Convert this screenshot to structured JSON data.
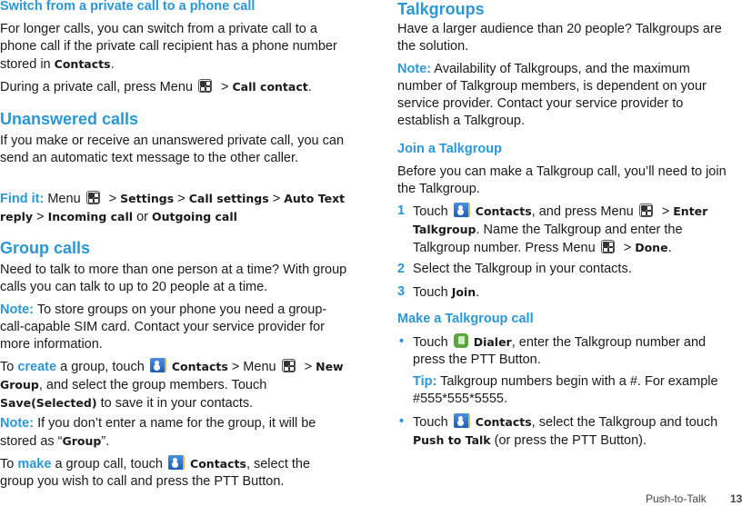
{
  "left": {
    "switch": {
      "heading": "Switch from a private call to a phone call",
      "p1_a": "For longer calls, you can switch from a private call to a phone call if the private call recipient has a phone number stored in ",
      "p1_b": "Contacts",
      "p1_c": ".",
      "p2_a": "During a private call, press Menu",
      "p2_b": " > ",
      "p2_c": "Call contact",
      "p2_d": "."
    },
    "unanswered": {
      "heading": "Unanswered calls",
      "p1": "If you make or receive an unanswered private call, you can send an automatic text message to the other caller.",
      "find_label": "Find it:",
      "find_menu": " Menu",
      "gt": " > ",
      "settings": "Settings",
      "call_settings": "Call settings",
      "auto_text": "Auto Text reply",
      "incoming": "Incoming call",
      "or": " or ",
      "outgoing": "Outgoing call"
    },
    "group": {
      "heading": "Group calls",
      "p1": "Need to talk to more than one person at a time? With group calls you can talk to up to 20 people at a time.",
      "note_label": "Note:",
      "note1": " To store groups on your phone you need a group-call-capable SIM card. Contact your service provider for more information.",
      "to": "To ",
      "create": "create",
      "create_a": " a group, touch ",
      "contacts": "Contacts",
      "menu_txt": " > Menu",
      "gt": " > ",
      "new_group": "New Group",
      "create_b": ", and select the group members. Touch ",
      "save_sel": "Save(Selected)",
      "create_c": " to save it in your contacts.",
      "note2_a": " If you don’t enter a name for the group, it will be stored as “",
      "group_word": "Group",
      "note2_b": "”.",
      "make": "make",
      "make_a": " a group call, touch ",
      "make_b": ", select the group you wish to call and press the PTT Button."
    }
  },
  "right": {
    "talkgroups": {
      "heading": "Talkgroups",
      "p1": "Have a larger audience than 20 people? Talkgroups are the solution.",
      "note_label": "Note:",
      "note": " Availability of Talkgroups, and the maximum number of Talkgroup members, is dependent on your service provider. Contact your service provider to establish a Talkgroup."
    },
    "join": {
      "heading": "Join a Talkgroup",
      "p1": "Before you can make a Talkgroup call, you’ll need to join the Talkgroup.",
      "steps": [
        {
          "num": "1",
          "touch": "Touch ",
          "contacts": "Contacts",
          "a": ", and press Menu",
          "gt": " > ",
          "enter": "Enter Talkgroup",
          "b": ". Name the Talkgroup and enter the Talkgroup number. Press Menu",
          "done": "Done",
          "end": "."
        },
        {
          "num": "2",
          "text": "Select the Talkgroup in your contacts."
        },
        {
          "num": "3",
          "touch": "Touch ",
          "join": "Join",
          "end": "."
        }
      ]
    },
    "make": {
      "heading": "Make a Talkgroup call",
      "bullet": "•",
      "b1_touch": "Touch",
      "b1_dialer": "Dialer",
      "b1_rest": ", enter the Talkgroup number and press the PTT Button.",
      "tip_label": "Tip:",
      "tip": " Talkgroup numbers begin with a #. For example #555*555*5555.",
      "b2_touch": "Touch ",
      "b2_contacts": "Contacts",
      "b2_a": ", select the Talkgroup and touch ",
      "b2_ptt": "Push to Talk",
      "b2_b": " (or press the PTT Button)."
    }
  },
  "footer": {
    "section": "Push-to-Talk",
    "page": "13"
  }
}
